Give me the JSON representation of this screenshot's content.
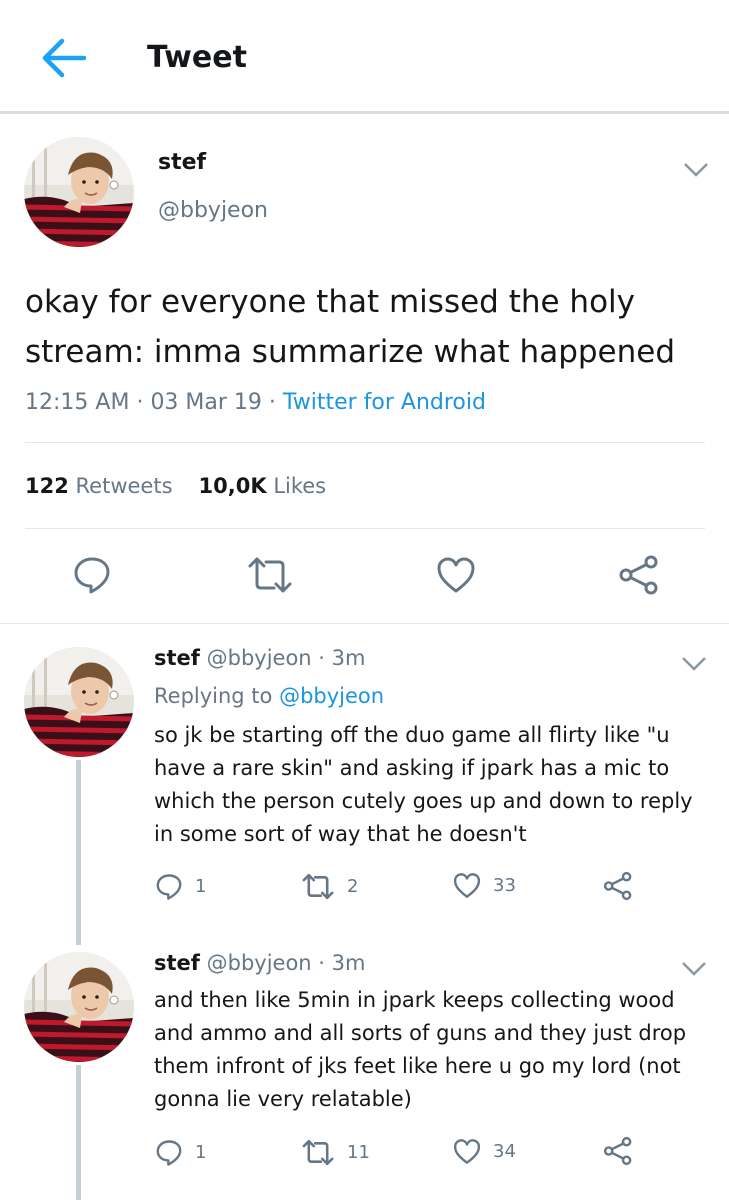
{
  "header": {
    "title": "Tweet",
    "back_icon": "arrow-left-icon",
    "accent": "#1da1f2"
  },
  "tweet": {
    "name": "stef",
    "handle": "@bbyjeon",
    "text": "okay for everyone that missed the holy stream: imma summarize what happened",
    "time": "12:15 AM",
    "sep1": "·",
    "date": "03 Mar 19",
    "sep2": "·",
    "source": "Twitter for Android",
    "retweets_count": "122",
    "retweets_label": "Retweets",
    "likes_count": "10,0K",
    "likes_label": "Likes",
    "actions": [
      "reply-icon",
      "retweet-icon",
      "like-icon",
      "share-icon"
    ]
  },
  "replies": [
    {
      "name": "stef",
      "handle": "@bbyjeon",
      "dot": "·",
      "time": "3m",
      "replying_label": "Replying to",
      "replying_to": "@bbyjeon",
      "text": "so jk be starting off the duo game all flirty like \"u have a rare skin\" and asking if jpark has a mic to which the person cutely goes up and down to reply in some sort of way that he doesn't",
      "reply_count": "1",
      "retweet_count": "2",
      "like_count": "33"
    },
    {
      "name": "stef",
      "handle": "@bbyjeon",
      "dot": "·",
      "time": "3m",
      "text": "and then like 5min in jpark keeps collecting wood and ammo and all sorts of guns and they just drop them infront of jks feet like here u go my lord (not gonna lie very relatable)",
      "reply_count": "1",
      "retweet_count": "11",
      "like_count": "34"
    }
  ],
  "colors": {
    "secondary_text": "#657786",
    "link": "#1b95e0",
    "thread_line": "#c4cfd6",
    "divider": "#e1e8ed"
  }
}
